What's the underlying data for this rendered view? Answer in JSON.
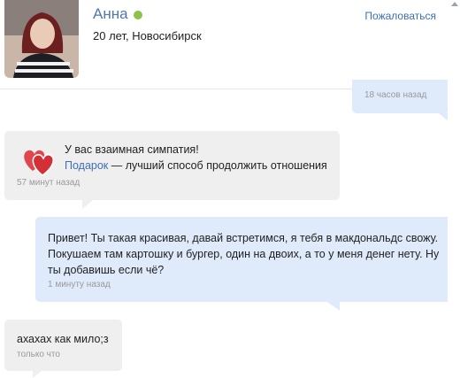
{
  "profile": {
    "name": "Анна",
    "subline": "20 лет, Новосибирск",
    "report_label": "Пожаловаться",
    "online_color": "#8bc34a"
  },
  "messages": [
    {
      "direction": "out",
      "time": "18 часов назад"
    },
    {
      "direction": "in",
      "type": "sympathy",
      "icon": "hearts-icon",
      "title": "У вас взаимная симпатия!",
      "link": "Подарок",
      "rest": " — лучший способ продолжить отношения",
      "time": "57 минут назад"
    },
    {
      "direction": "out",
      "text": "Привет! Ты такая красивая, давай встретимся, я тебя в макдональдс свожу. Покушаем там картошку и бургер, один на двоих, а то у меня денег нету. Ну ты добавишь если чё?",
      "time": "1 минуту назад"
    },
    {
      "direction": "in",
      "text": "ахахах как мило;з",
      "time": "только что"
    }
  ],
  "colors": {
    "incoming_bubble": "#efefef",
    "outgoing_bubble": "#dfeafa",
    "link": "#3d6fb4",
    "name": "#4f78b0"
  }
}
